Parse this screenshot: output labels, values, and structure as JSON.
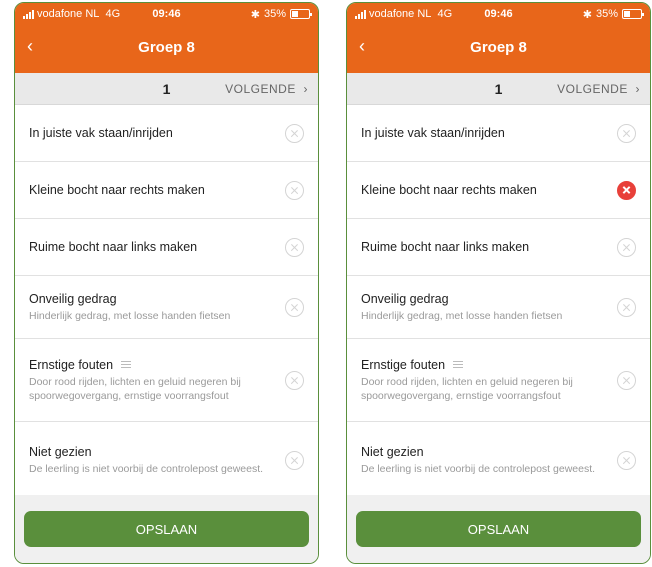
{
  "status": {
    "carrier": "vodafone NL",
    "network": "4G",
    "time": "09:46",
    "battery": "35%"
  },
  "nav": {
    "back_icon": "chevron-left-icon",
    "title": "Groep 8"
  },
  "pager": {
    "number": "1",
    "next_label": "VOLGENDE",
    "next_icon": "chevron-right-icon"
  },
  "items": [
    {
      "label": "In juiste vak staan/inrijden",
      "sub": ""
    },
    {
      "label": "Kleine bocht naar rechts maken",
      "sub": ""
    },
    {
      "label": "Ruime bocht naar links maken",
      "sub": ""
    },
    {
      "label": "Onveilig gedrag",
      "sub": "Hinderlijk gedrag, met losse handen fietsen"
    },
    {
      "label": "Ernstige fouten",
      "sub": "Door rood rijden, lichten en geluid negeren bij spoorwegovergang, ernstige voorrangsfout"
    },
    {
      "label": "Niet gezien",
      "sub": "De leerling is niet voorbij de controlepost geweest."
    }
  ],
  "save_label": "OPSLAAN",
  "colors": {
    "header": "#e8661a",
    "save": "#5a8f3c",
    "error_active": "#e8403a"
  },
  "screens": [
    {
      "selected_item": null
    },
    {
      "selected_item": "Kleine bocht naar rechts maken"
    }
  ]
}
